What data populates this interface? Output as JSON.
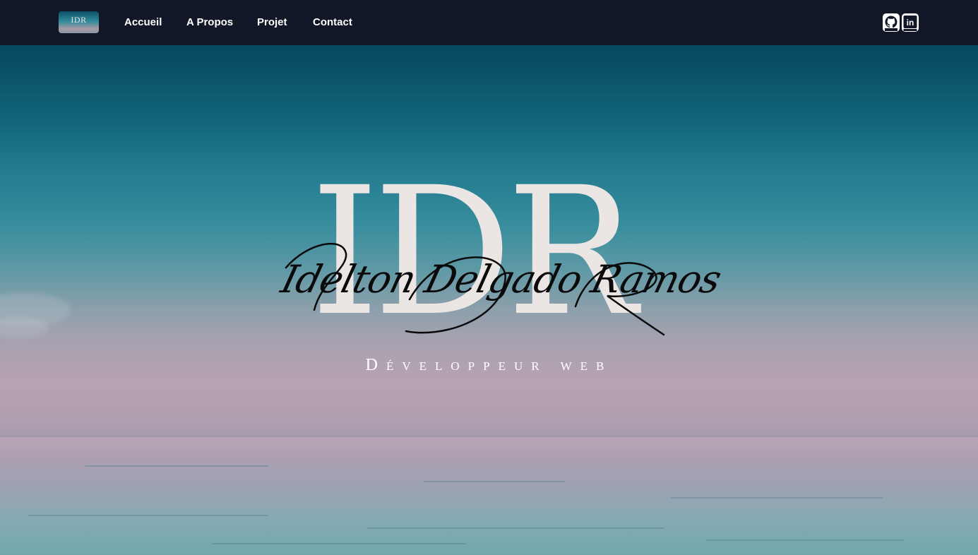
{
  "nav": {
    "logo_text": "IDR",
    "links": [
      "Accueil",
      "A Propos",
      "Projet",
      "Contact"
    ],
    "social": [
      {
        "icon": "github-icon",
        "label": "GitHub"
      },
      {
        "icon": "linkedin-icon",
        "label": "in"
      }
    ]
  },
  "hero": {
    "monogram": "IDR",
    "signature": "Idelton Delgado Ramos",
    "subtitle": "Développeur web"
  },
  "colors": {
    "nav_background": "#121728",
    "monogram": "#ebe6e3",
    "signature": "#0a0a0a",
    "subtitle": "#ffffff"
  }
}
